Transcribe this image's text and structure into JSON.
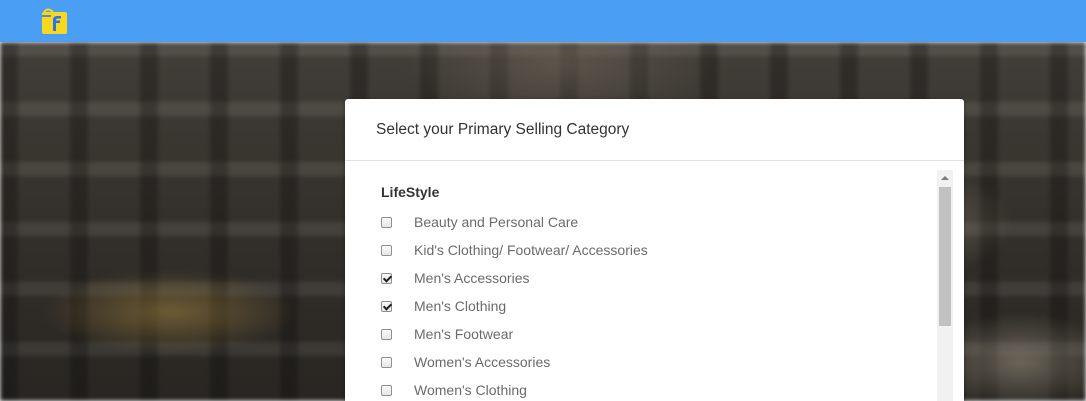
{
  "header": {
    "logo_icon": "flipkart-logo-icon",
    "bar_color": "#4a9ff5"
  },
  "card": {
    "title": "Select your Primary Selling Category",
    "group": {
      "title": "LifeStyle",
      "options": [
        {
          "label": "Beauty and Personal Care",
          "checked": false
        },
        {
          "label": "Kid's Clothing/ Footwear/ Accessories",
          "checked": false
        },
        {
          "label": "Men's Accessories",
          "checked": true
        },
        {
          "label": "Men's Clothing",
          "checked": true
        },
        {
          "label": "Men's Footwear",
          "checked": false
        },
        {
          "label": "Women's Accessories",
          "checked": false
        },
        {
          "label": "Women's Clothing",
          "checked": false
        }
      ]
    }
  }
}
